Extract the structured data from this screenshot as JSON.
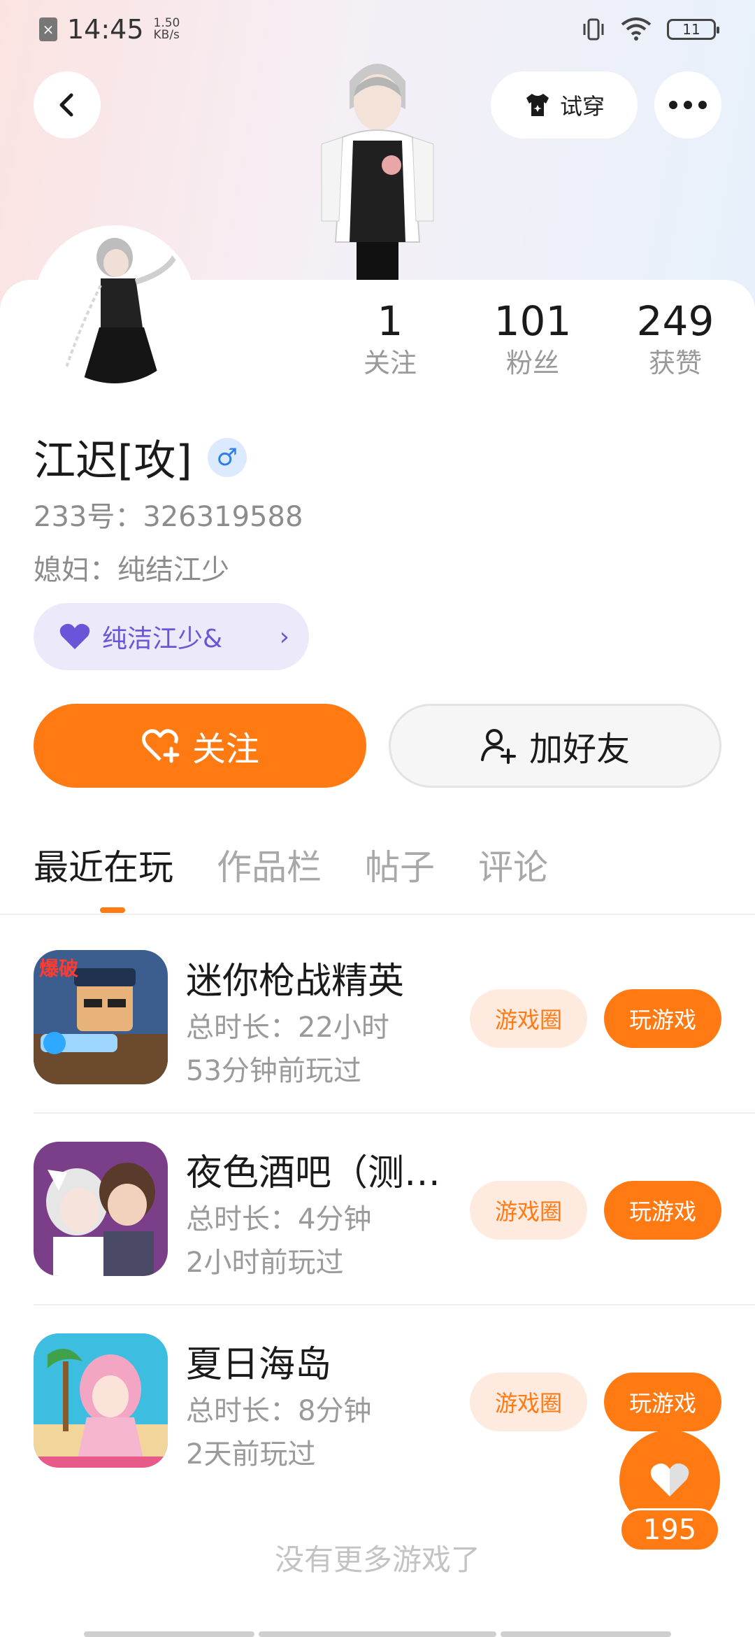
{
  "status_bar": {
    "time": "14:45",
    "net_speed_value": "1.50",
    "net_speed_unit": "KB/s",
    "battery": "11"
  },
  "header": {
    "try_on_label": "试穿"
  },
  "stats": [
    {
      "value": "1",
      "label": "关注"
    },
    {
      "value": "101",
      "label": "粉丝"
    },
    {
      "value": "249",
      "label": "获赞"
    }
  ],
  "profile": {
    "name": "江迟[攻]",
    "gender_symbol": "♂",
    "id_line": "233号：326319588",
    "wife_line": "媳妇：纯结江少",
    "cp_chip": "纯洁江少&"
  },
  "actions": {
    "follow_label": "关注",
    "add_friend_label": "加好友"
  },
  "tabs": [
    "最近在玩",
    "作品栏",
    "帖子",
    "评论"
  ],
  "games": [
    {
      "title": "迷你枪战精英",
      "total_time": "总时长：22小时",
      "last_played": "53分钟前玩过",
      "circle_label": "游戏圈",
      "play_label": "玩游戏",
      "icon": "mini-gunfight-game-icon",
      "icon_text": "爆破"
    },
    {
      "title": "夜色酒吧（测…",
      "total_time": "总时长：4分钟",
      "last_played": "2小时前玩过",
      "circle_label": "游戏圈",
      "play_label": "玩游戏",
      "icon": "night-bar-game-icon"
    },
    {
      "title": "夏日海岛",
      "total_time": "总时长：8分钟",
      "last_played": "2天前玩过",
      "circle_label": "游戏圈",
      "play_label": "玩游戏",
      "icon": "summer-island-game-icon"
    }
  ],
  "footer": {
    "no_more_text": "没有更多游戏了",
    "like_count": "195"
  },
  "colors": {
    "accent": "#ff7a13",
    "cp_purple": "#6a55d8",
    "gender_blue": "#2f7ee8"
  }
}
